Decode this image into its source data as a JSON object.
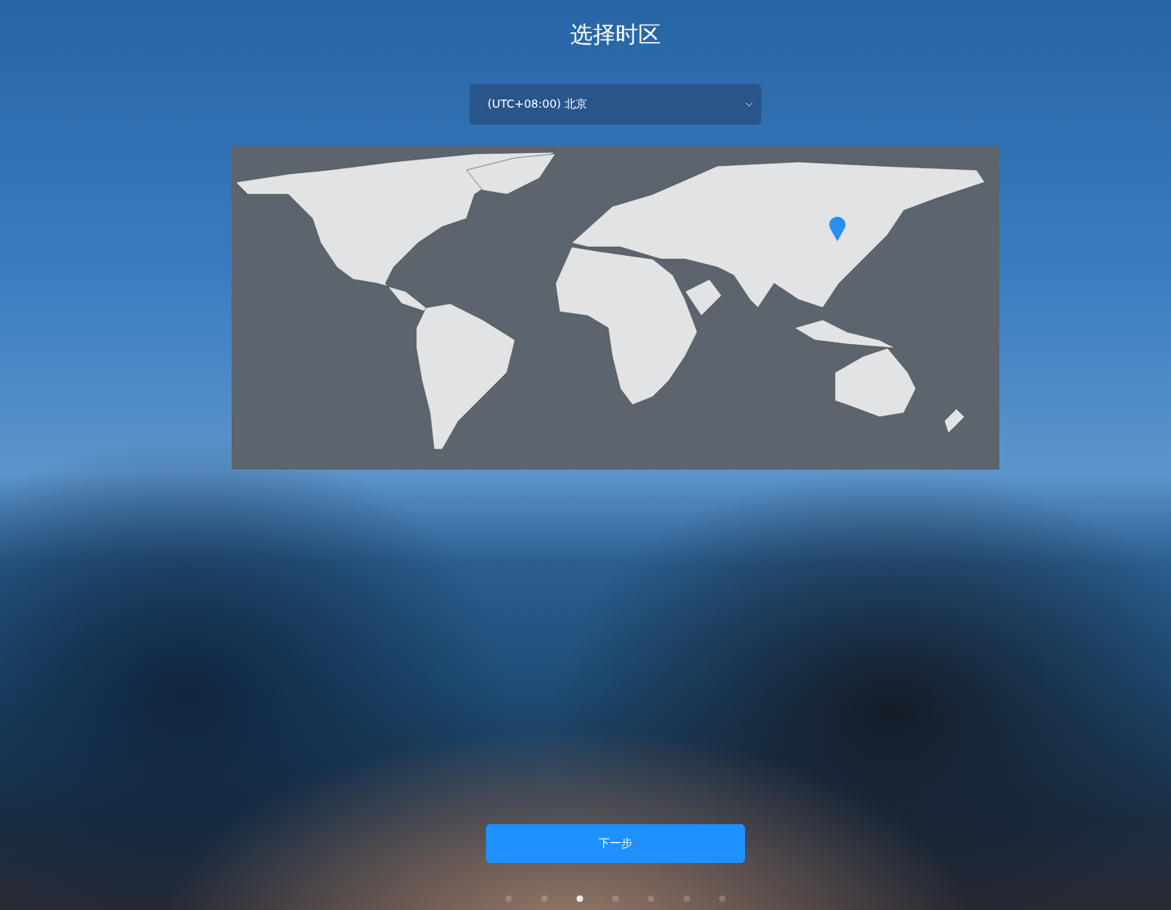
{
  "title": "选择时区",
  "timezone_select": {
    "value": "(UTC+08:00) 北京"
  },
  "next_button": {
    "label": "下一步"
  },
  "pager": [
    {
      "selected": false
    },
    {
      "selected": false
    },
    {
      "selected": true
    },
    {
      "selected": false
    },
    {
      "selected": false
    },
    {
      "selected": false
    },
    {
      "selected": false
    }
  ]
}
